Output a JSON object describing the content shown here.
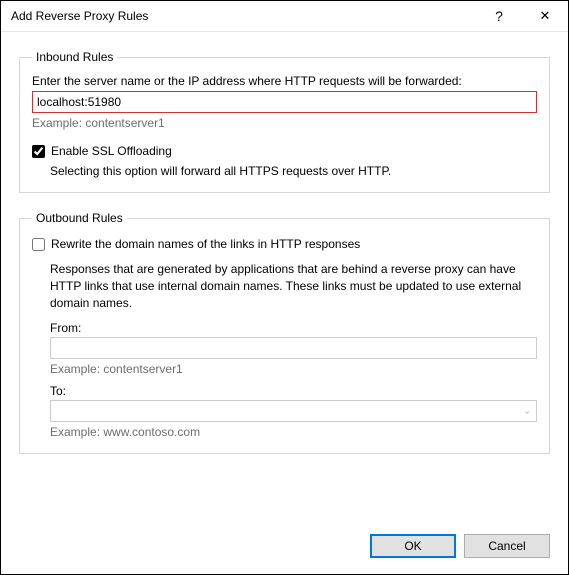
{
  "window": {
    "title": "Add Reverse Proxy Rules",
    "help_glyph": "?",
    "close_glyph": "✕"
  },
  "inbound": {
    "legend": "Inbound Rules",
    "prompt": "Enter the server name or the IP address where HTTP requests will be forwarded:",
    "value": "localhost:51980",
    "example": "Example: contentserver1",
    "ssl_label": "Enable SSL Offloading",
    "ssl_checked": true,
    "ssl_desc": "Selecting this option will forward all HTTPS requests over HTTP."
  },
  "outbound": {
    "legend": "Outbound Rules",
    "rewrite_label": "Rewrite the domain names of the links in HTTP responses",
    "rewrite_checked": false,
    "desc": "Responses that are generated by applications that are behind a reverse proxy can have HTTP links that use internal domain names. These links must be updated to use external domain names.",
    "from_label": "From:",
    "from_value": "",
    "from_example": "Example: contentserver1",
    "to_label": "To:",
    "to_value": "",
    "to_example": "Example: www.contoso.com"
  },
  "buttons": {
    "ok": "OK",
    "cancel": "Cancel"
  }
}
